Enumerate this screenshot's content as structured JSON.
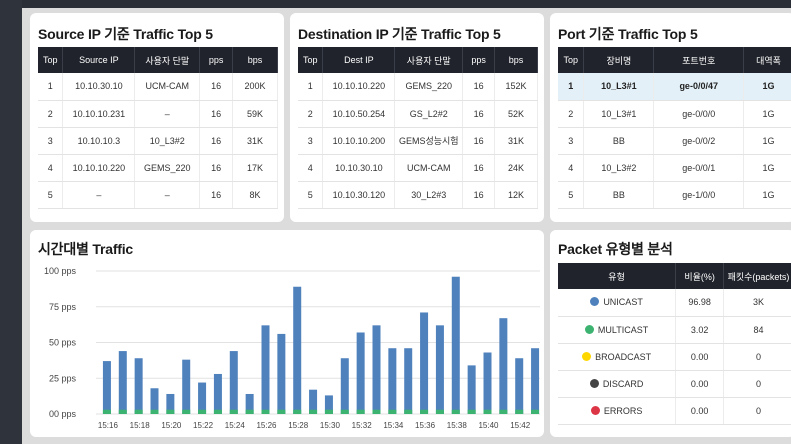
{
  "source_panel": {
    "title": "Source IP 기준 Traffic Top 5",
    "headers": [
      "Top",
      "Source IP",
      "사용자 단말",
      "pps",
      "bps"
    ],
    "rows": [
      [
        "1",
        "10.10.30.10",
        "UCM-CAM",
        "16",
        "200K"
      ],
      [
        "2",
        "10.10.10.231",
        "–",
        "16",
        "59K"
      ],
      [
        "3",
        "10.10.10.3",
        "10_L3#2",
        "16",
        "31K"
      ],
      [
        "4",
        "10.10.10.220",
        "GEMS_220",
        "16",
        "17K"
      ],
      [
        "5",
        "–",
        "–",
        "16",
        "8K"
      ]
    ]
  },
  "dest_panel": {
    "title": "Destination IP 기준 Traffic Top 5",
    "headers": [
      "Top",
      "Dest IP",
      "사용자 단말",
      "pps",
      "bps"
    ],
    "rows": [
      [
        "1",
        "10.10.10.220",
        "GEMS_220",
        "16",
        "152K"
      ],
      [
        "2",
        "10.10.50.254",
        "GS_L2#2",
        "16",
        "52K"
      ],
      [
        "3",
        "10.10.10.200",
        "GEMS성능시험",
        "16",
        "31K"
      ],
      [
        "4",
        "10.10.30.10",
        "UCM-CAM",
        "16",
        "24K"
      ],
      [
        "5",
        "10.10.30.120",
        "30_L2#3",
        "16",
        "12K"
      ]
    ]
  },
  "port_panel": {
    "title": "Port 기준 Traffic Top 5",
    "headers": [
      "Top",
      "장비명",
      "포트번호",
      "대역폭"
    ],
    "rows": [
      [
        "1",
        "10_L3#1",
        "ge-0/0/47",
        "1G"
      ],
      [
        "2",
        "10_L3#1",
        "ge-0/0/0",
        "1G"
      ],
      [
        "3",
        "BB",
        "ge-0/0/2",
        "1G"
      ],
      [
        "4",
        "10_L3#2",
        "ge-0/0/1",
        "1G"
      ],
      [
        "5",
        "BB",
        "ge-1/0/0",
        "1G"
      ]
    ]
  },
  "time_panel": {
    "title": "시간대별 Traffic"
  },
  "packet_panel": {
    "title": "Packet 유형별 분석",
    "headers": [
      "유형",
      "비율(%)",
      "패킷수(packets)"
    ],
    "rows": [
      {
        "type": "UNICAST",
        "ratio": "96.98",
        "packets": "3K",
        "color": "#4f81bd"
      },
      {
        "type": "MULTICAST",
        "ratio": "3.02",
        "packets": "84",
        "color": "#3cb371"
      },
      {
        "type": "BROADCAST",
        "ratio": "0.00",
        "packets": "0",
        "color": "#ffd700"
      },
      {
        "type": "DISCARD",
        "ratio": "0.00",
        "packets": "0",
        "color": "#444444"
      },
      {
        "type": "ERRORS",
        "ratio": "0.00",
        "packets": "0",
        "color": "#dc3545"
      }
    ]
  },
  "chart_data": {
    "type": "bar",
    "ylim": [
      0,
      100
    ],
    "yticks": [
      0,
      25,
      50,
      75,
      100
    ],
    "ytick_labels": [
      "00 pps",
      "25 pps",
      "50 pps",
      "75 pps",
      "100 pps"
    ],
    "xtick_labels": [
      "15:16",
      "15:18",
      "15:20",
      "15:22",
      "15:24",
      "15:26",
      "15:28",
      "15:30",
      "15:32",
      "15:34",
      "15:36",
      "15:38",
      "15:40",
      "15:42"
    ],
    "series": [
      {
        "color": "#4f81bd",
        "values": [
          37,
          44,
          39,
          18,
          14,
          38,
          22,
          28,
          44,
          14,
          62,
          56,
          89,
          17,
          13,
          39,
          57,
          62,
          46,
          46,
          71,
          62,
          96,
          34,
          43,
          67,
          39,
          46
        ]
      },
      {
        "color": "#3cb371",
        "values": [
          3,
          3,
          3,
          3,
          3,
          3,
          3,
          3,
          3,
          3,
          3,
          3,
          3,
          3,
          3,
          3,
          3,
          3,
          3,
          3,
          3,
          3,
          3,
          3,
          3,
          3,
          3,
          3
        ]
      }
    ]
  }
}
